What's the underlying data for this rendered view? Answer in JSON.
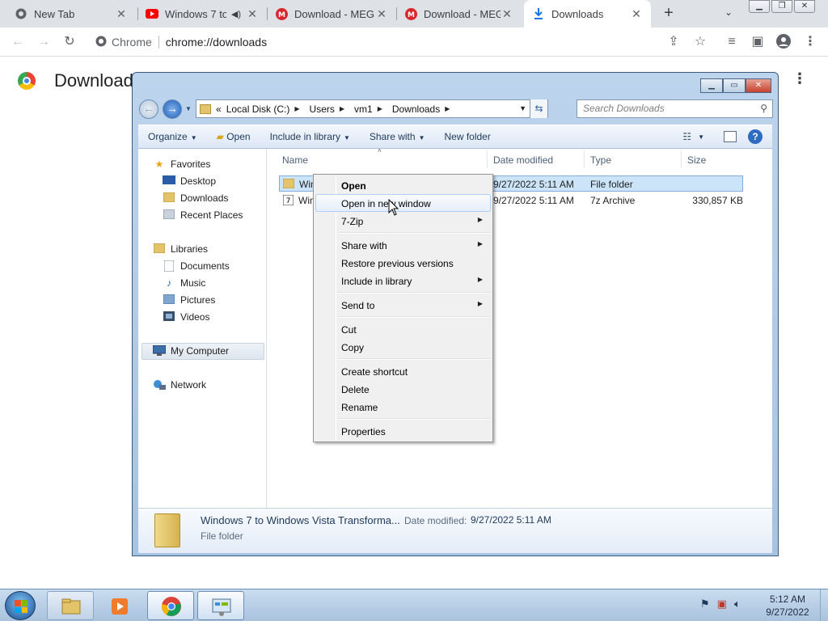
{
  "chrome": {
    "tabs": [
      {
        "title": "New Tab",
        "icon": "chrome-icon",
        "active": false
      },
      {
        "title": "Windows 7 to",
        "icon": "youtube-icon",
        "active": false
      },
      {
        "title": "Download - MEG",
        "icon": "mega-icon",
        "active": false
      },
      {
        "title": "Download - MEG",
        "icon": "mega-icon",
        "active": false
      },
      {
        "title": "Downloads",
        "icon": "download-icon",
        "active": true
      }
    ],
    "omnibox": {
      "site": "Chrome",
      "url": "chrome://downloads"
    },
    "page_title": "Downloads"
  },
  "explorer": {
    "breadcrumb": [
      "«",
      "Local Disk (C:)",
      "Users",
      "vm1",
      "Downloads"
    ],
    "search_placeholder": "Search Downloads",
    "commands": [
      "Organize",
      "Open",
      "Include in library",
      "Share with",
      "New folder"
    ],
    "navpane": {
      "favorites_header": "Favorites",
      "favorites": [
        "Desktop",
        "Downloads",
        "Recent Places"
      ],
      "libraries_header": "Libraries",
      "libraries": [
        "Documents",
        "Music",
        "Pictures",
        "Videos"
      ],
      "computer": "My Computer",
      "network": "Network"
    },
    "columns": [
      "Name",
      "Date modified",
      "Type",
      "Size"
    ],
    "files": [
      {
        "name": "Win",
        "date": "9/27/2022 5:11 AM",
        "type": "File folder",
        "size": ""
      },
      {
        "name": "Win",
        "date": "9/27/2022 5:11 AM",
        "type": "7z Archive",
        "size": "330,857 KB"
      }
    ],
    "details": {
      "name": "Windows 7 to Windows Vista Transforma...",
      "date_label": "Date modified:",
      "date_value": "9/27/2022 5:11 AM",
      "type": "File folder"
    }
  },
  "context_menu": {
    "items": [
      {
        "label": "Open",
        "bold": true
      },
      {
        "label": "Open in new window",
        "hover": true
      },
      {
        "label": "7-Zip",
        "submenu": true
      },
      {
        "label": "Share with",
        "submenu": true
      },
      {
        "label": "Restore previous versions"
      },
      {
        "label": "Include in library",
        "submenu": true
      },
      {
        "label": "Send to",
        "submenu": true
      },
      {
        "label": "Cut"
      },
      {
        "label": "Copy"
      },
      {
        "label": "Create shortcut"
      },
      {
        "label": "Delete"
      },
      {
        "label": "Rename"
      },
      {
        "label": "Properties"
      }
    ]
  },
  "taskbar": {
    "time": "5:12 AM",
    "date": "9/27/2022"
  }
}
